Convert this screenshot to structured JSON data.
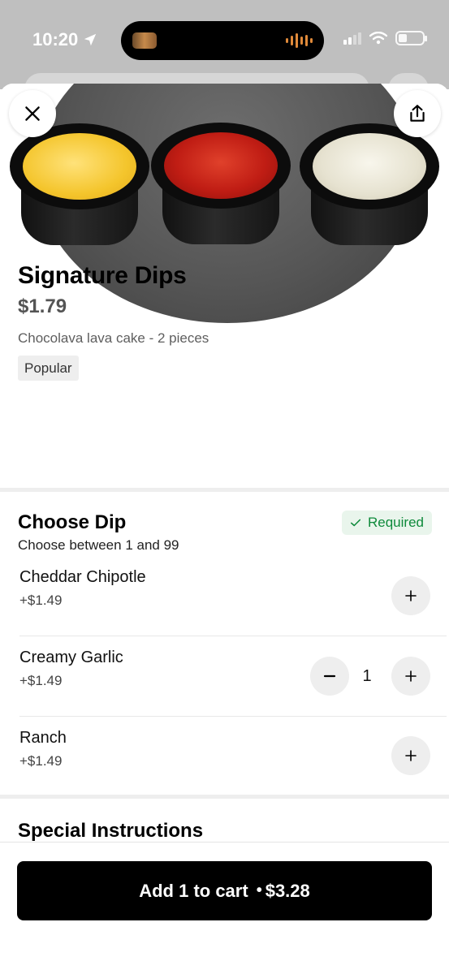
{
  "status_bar": {
    "time": "10:20"
  },
  "header": {
    "close_icon": "close-icon",
    "share_icon": "share-icon"
  },
  "item": {
    "title": "Signature Dips",
    "price": "$1.79",
    "description": "Chocolava lava cake - 2 pieces",
    "badge": "Popular"
  },
  "choose_dip": {
    "title": "Choose Dip",
    "subtitle": "Choose between 1 and 99",
    "required_label": "Required",
    "options": [
      {
        "name": "Cheddar Chipotle",
        "price": "+$1.49",
        "quantity": 0
      },
      {
        "name": "Creamy Garlic",
        "price": "+$1.49",
        "quantity": "1"
      },
      {
        "name": "Ranch",
        "price": "+$1.49",
        "quantity": 0
      }
    ]
  },
  "special_instructions": {
    "title": "Special Instructions"
  },
  "cart": {
    "label": "Add 1 to cart",
    "separator": "•",
    "total": "$3.28"
  },
  "colors": {
    "accent_green": "#0e8a3b",
    "required_bg": "#e9f5ec",
    "button_black": "#000000"
  }
}
